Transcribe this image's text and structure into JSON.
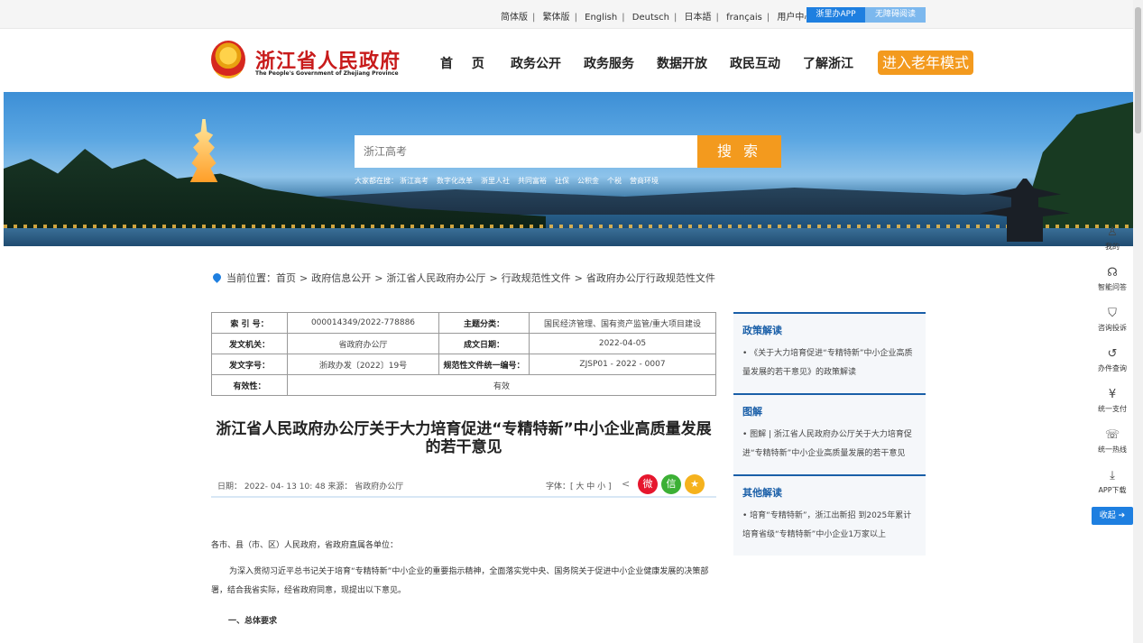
{
  "topbar": {
    "languages": [
      "简体版",
      "繁体版",
      "English",
      "Deutsch",
      "日本語",
      "français",
      "用户中心"
    ],
    "app_button": "浙里办APP",
    "accessible_button": "无障碍阅读"
  },
  "header": {
    "site_title": "浙江省人民政府",
    "site_subtitle": "The People's Government of Zhejiang Province",
    "nav": [
      "首 页",
      "政务公开",
      "政务服务",
      "数据开放",
      "政民互动",
      "了解浙江"
    ],
    "old_mode_button": "进入老年模式"
  },
  "search": {
    "placeholder": "浙江高考",
    "button": "搜 索",
    "hot_lead": "大家都在搜：",
    "hot": [
      "浙江高考",
      "数字化改革",
      "浙里人社",
      "共同富裕",
      "社保",
      "公积金",
      "个税",
      "营商环境"
    ]
  },
  "breadcrumb": {
    "lead": "当前位置：",
    "items": [
      "首页",
      "政府信息公开",
      "浙江省人民政府办公厅",
      "行政规范性文件",
      "省政府办公厅行政规范性文件"
    ]
  },
  "meta": {
    "index_label": "索 引 号：",
    "index_value": "000014349/2022-778886",
    "topic_label": "主题分类：",
    "topic_value": "国民经济管理、国有资产监管/重大项目建设",
    "issuer_label": "发文机关：",
    "issuer_value": "省政府办公厅",
    "date_label": "成文日期：",
    "date_value": "2022-04-05",
    "docno_label": "发文字号：",
    "docno_value": "浙政办发〔2022〕19号",
    "code_label": "规范性文件统一编号：",
    "code_value": "ZJSP01 - 2022 - 0007",
    "valid_label": "有效性：",
    "valid_value": "有效"
  },
  "article": {
    "title": "浙江省人民政府办公厅关于大力培育促进“专精特新”中小企业高质量发展的若干意见",
    "info": "日期： 2022- 04- 13 10: 48  来源： 省政府办公厅",
    "font_size": "字体：[ 大 中 小 ]",
    "salutation": "各市、县（市、区）人民政府，省政府直属各单位：",
    "para1": "为深入贯彻习近平总书记关于培育“专精特新”中小企业的重要指示精神，全面落实党中央、国务院关于促进中小企业健康发展的决策部署，结合我省实际，经省政府同意，现提出以下意见。",
    "section1": "一、总体要求"
  },
  "sidebar": {
    "sections": [
      {
        "title": "政策解读",
        "item": "• 《关于大力培育促进“专精特新”中小企业高质量发展的若干意见》的政策解读"
      },
      {
        "title": "图解",
        "item": "• 图解 | 浙江省人民政府办公厅关于大力培育促进“专精特新”中小企业高质量发展的若干意见"
      },
      {
        "title": "其他解读",
        "item": "• 培育“专精特新”，浙江出新招 到2025年累计培育省级“专精特新”中小企业1万家以上"
      }
    ]
  },
  "float_bar": {
    "items": [
      "我的",
      "智能问答",
      "咨询投诉",
      "办件查询",
      "统一支付",
      "统一热线",
      "APP下载"
    ],
    "collapse": "收起"
  },
  "colors": {
    "accent": "#1e7fe0",
    "orange": "#f39a1e",
    "title_red": "#c81b1b"
  }
}
